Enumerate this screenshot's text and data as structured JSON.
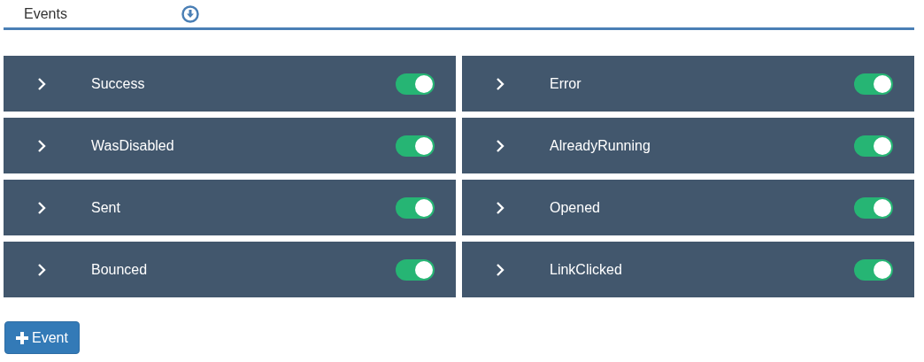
{
  "header": {
    "title": "Events"
  },
  "events": [
    {
      "name": "Success",
      "on": true
    },
    {
      "name": "Error",
      "on": true
    },
    {
      "name": "WasDisabled",
      "on": true
    },
    {
      "name": "AlreadyRunning",
      "on": true
    },
    {
      "name": "Sent",
      "on": true
    },
    {
      "name": "Opened",
      "on": true
    },
    {
      "name": "Bounced",
      "on": true
    },
    {
      "name": "LinkClicked",
      "on": true
    }
  ],
  "add_button": {
    "label": "Event"
  }
}
